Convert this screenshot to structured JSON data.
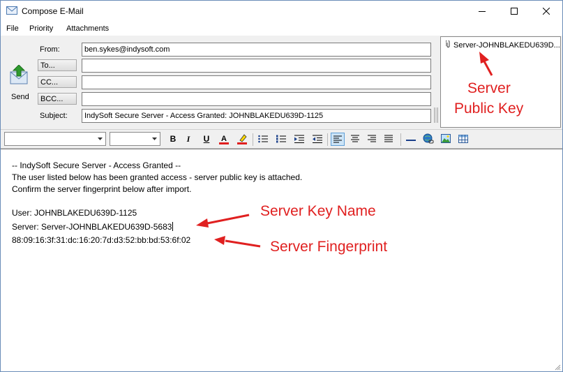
{
  "window": {
    "title": "Compose E-Mail"
  },
  "menu": {
    "items": [
      "File",
      "Priority",
      "Attachments"
    ]
  },
  "send": {
    "label": "Send"
  },
  "fields": {
    "from_label": "From:",
    "from_value": "ben.sykes@indysoft.com",
    "to_label": "To...",
    "to_value": "",
    "cc_label": "CC...",
    "cc_value": "",
    "bcc_label": "BCC...",
    "bcc_value": "",
    "subject_label": "Subject:",
    "subject_value": "IndySoft Secure Server - Access Granted: JOHNBLAKEDU639D-1125"
  },
  "attachments": [
    {
      "name": "Server-JOHNBLAKEDU639D..."
    }
  ],
  "toolbar": {
    "font_value": "",
    "size_value": "",
    "bold": "B",
    "italic": "I",
    "underline": "U"
  },
  "body": {
    "lines": [
      "-- IndySoft Secure Server - Access Granted --",
      "The user listed below has been granted access - server public key is attached.",
      "Confirm the server fingerprint below after import.",
      "",
      "User:  JOHNBLAKEDU639D-1125",
      "Server:  Server-JOHNBLAKEDU639D-5683",
      "88:09:16:3f:31:dc:16:20:7d:d3:52:bb:bd:53:6f:02"
    ]
  },
  "annotations": {
    "public_key_line1": "Server",
    "public_key_line2": "Public Key",
    "key_name": "Server Key Name",
    "fingerprint": "Server Fingerprint"
  },
  "colors": {
    "annotation": "#e02020",
    "accent": "#cce4f7"
  }
}
